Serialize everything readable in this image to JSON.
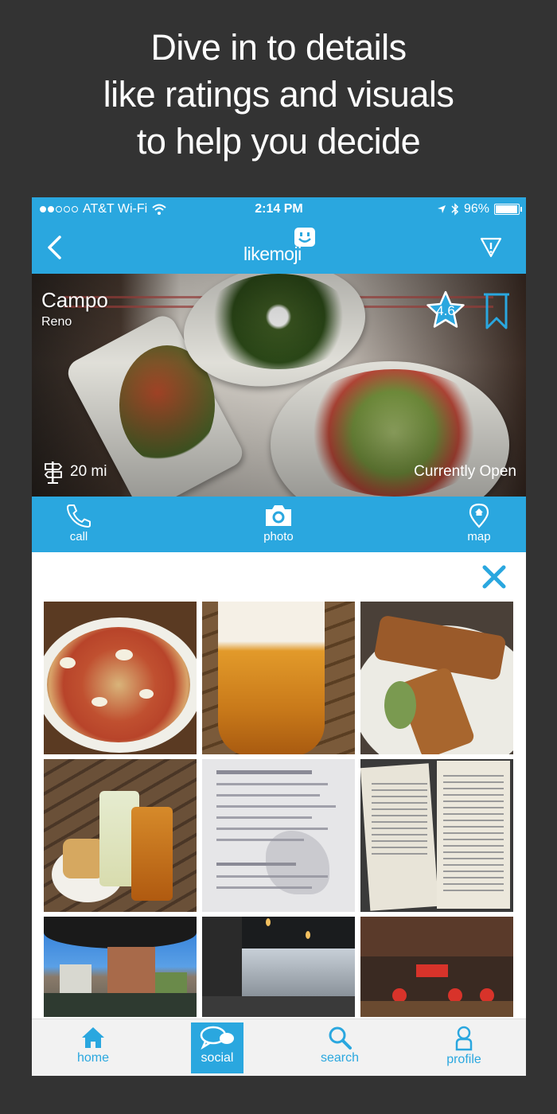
{
  "headline": {
    "lines": [
      "Dive in to details",
      "like ratings and visuals",
      "to help you decide"
    ]
  },
  "status_bar": {
    "carrier": "AT&T Wi-Fi",
    "time": "2:14 PM",
    "battery": "96%",
    "battery_level": 0.96
  },
  "nav": {
    "logo": "likemoji",
    "icons": [
      "back-chevron-icon",
      "report-flag-icon"
    ]
  },
  "place": {
    "name": "Campo",
    "city": "Reno",
    "rating": "4.6",
    "distance": "20 mi",
    "status": "Currently Open"
  },
  "actions": [
    {
      "label": "call",
      "icon": "phone-icon"
    },
    {
      "label": "photo",
      "icon": "camera-icon"
    },
    {
      "label": "map",
      "icon": "map-pin-icon"
    }
  ],
  "gallery": {
    "photos": [
      "pizza",
      "beer",
      "fried-fish",
      "cocktails",
      "menu",
      "menu-open",
      "city-view",
      "patio",
      "kitchen"
    ]
  },
  "tabs": [
    {
      "label": "home",
      "icon": "home-icon",
      "active": false
    },
    {
      "label": "social",
      "icon": "chat-bubbles-icon",
      "active": true
    },
    {
      "label": "search",
      "icon": "search-icon",
      "active": false
    },
    {
      "label": "profile",
      "icon": "profile-icon",
      "active": false
    }
  ],
  "colors": {
    "accent": "#2aa7df",
    "background": "#333333",
    "tabbar": "#f2f2f2"
  }
}
